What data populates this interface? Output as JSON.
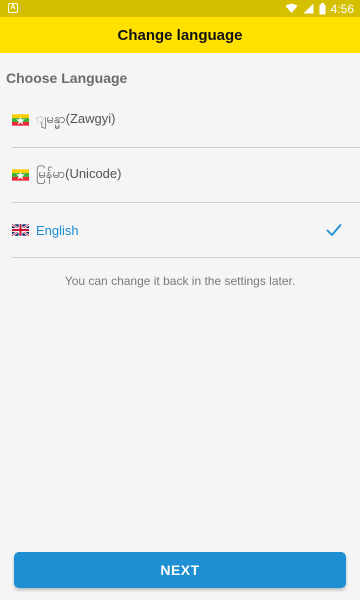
{
  "status_bar": {
    "time": "4:56",
    "app_icon": "A"
  },
  "toolbar": {
    "title": "Change language"
  },
  "section": {
    "title": "Choose Language"
  },
  "languages": [
    {
      "label": "ျမန္မာ(Zawgyi)",
      "flag": "myanmar-flag",
      "selected": false
    },
    {
      "label": "မြန်မာ(Unicode)",
      "flag": "myanmar-flag",
      "selected": false
    },
    {
      "label": "English",
      "flag": "uk-flag",
      "selected": true
    }
  ],
  "hint": "You can change it back in the settings later.",
  "next_button": {
    "label": "NEXT"
  },
  "colors": {
    "status_bar": "#d4c000",
    "toolbar": "#ffe100",
    "accent": "#1d8fd2",
    "background": "#f5f5f5"
  }
}
